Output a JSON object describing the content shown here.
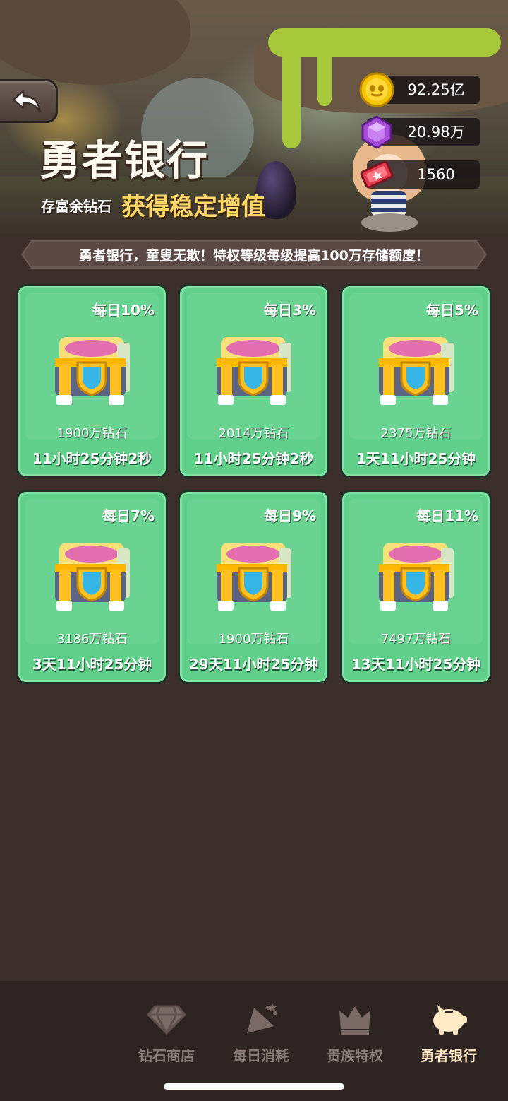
{
  "header": {
    "title": "勇者银行",
    "subtitle_small": "存富余钻石",
    "subtitle_big": "获得稳定增值"
  },
  "currencies": {
    "gold": "92.25亿",
    "gems": "20.98万",
    "tickets": "1560"
  },
  "notice": "勇者银行，童叟无欺！特权等级每级提高100万存储额度！",
  "cards": [
    {
      "rate": "每日10%",
      "amount": "1900万钻石",
      "timer": "11小时25分钟2秒"
    },
    {
      "rate": "每日3%",
      "amount": "2014万钻石",
      "timer": "11小时25分钟2秒"
    },
    {
      "rate": "每日5%",
      "amount": "2375万钻石",
      "timer": "1天11小时25分钟"
    },
    {
      "rate": "每日7%",
      "amount": "3186万钻石",
      "timer": "3天11小时25分钟"
    },
    {
      "rate": "每日9%",
      "amount": "1900万钻石",
      "timer": "29天11小时25分钟"
    },
    {
      "rate": "每日11%",
      "amount": "7497万钻石",
      "timer": "13天11小时25分钟"
    }
  ],
  "nav": [
    {
      "label": "钻石商店",
      "icon": "diamond-icon"
    },
    {
      "label": "每日消耗",
      "icon": "party-popper-icon"
    },
    {
      "label": "贵族特权",
      "icon": "crown-icon"
    },
    {
      "label": "勇者银行",
      "icon": "piggy-bank-icon",
      "active": true
    }
  ],
  "colors": {
    "card_green": "#5fcf8a",
    "background": "#3b2e2b",
    "title_gold": "#ffd766",
    "nav_active": "#ffe9c4",
    "nav_inactive": "#8c7f7a"
  }
}
